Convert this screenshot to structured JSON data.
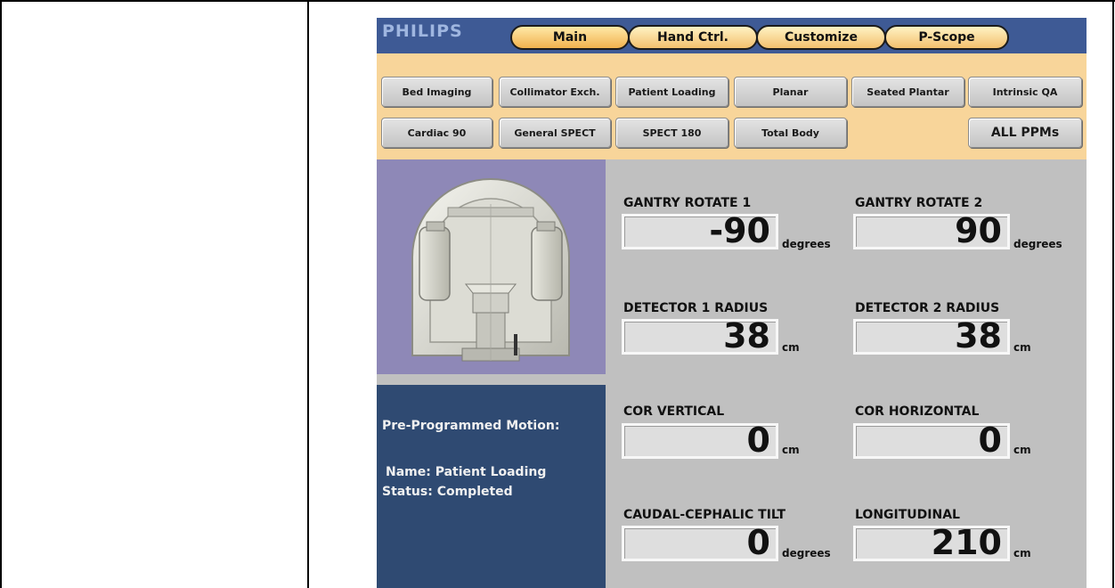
{
  "header": {
    "logo": "PHILIPS",
    "tabs": [
      {
        "label": "Main",
        "active": true
      },
      {
        "label": "Hand Ctrl.",
        "active": false
      },
      {
        "label": "Customize",
        "active": false
      },
      {
        "label": "P-Scope",
        "active": false
      }
    ]
  },
  "ppm_buttons": {
    "row1": [
      "Bed Imaging",
      "Collimator Exch.",
      "Patient Loading",
      "Planar",
      "Seated Plantar",
      "Intrinsic QA"
    ],
    "row2": [
      "Cardiac 90",
      "General SPECT",
      "SPECT 180",
      "Total Body"
    ],
    "all": "ALL PPMs"
  },
  "motion_info": {
    "title": "Pre-Programmed Motion:",
    "name_line": "Name: Patient Loading",
    "status_line": "Status: Completed"
  },
  "readouts": [
    {
      "label": "GANTRY ROTATE 1",
      "value": "-90",
      "unit": "degrees"
    },
    {
      "label": "GANTRY ROTATE 2",
      "value": "90",
      "unit": "degrees"
    },
    {
      "label": "DETECTOR 1 RADIUS",
      "value": "38",
      "unit": "cm"
    },
    {
      "label": "DETECTOR 2 RADIUS",
      "value": "38",
      "unit": "cm"
    },
    {
      "label": "COR VERTICAL",
      "value": "0",
      "unit": "cm"
    },
    {
      "label": "COR HORIZONTAL",
      "value": "0",
      "unit": "cm"
    },
    {
      "label": "CAUDAL-CEPHALIC TILT",
      "value": "0",
      "unit": "degrees"
    },
    {
      "label": "LONGITUDINAL",
      "value": "210",
      "unit": "cm"
    }
  ],
  "colors": {
    "header": "#3e5a95",
    "toolbar": "#f8d59a",
    "image_panel": "#8e88b7",
    "info_panel": "#2f4a72",
    "background": "#c0c0c0"
  }
}
